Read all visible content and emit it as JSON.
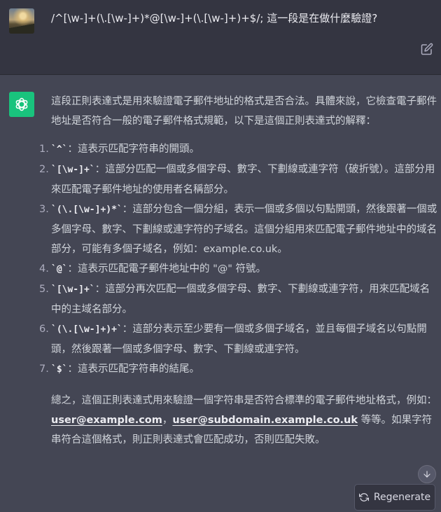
{
  "user_message": {
    "text": "/^[\\w-]+(\\.[\\w-]+)*@[\\w-]+(\\.[\\w-]+)+$/; 這一段是在做什麼驗證?"
  },
  "assistant_message": {
    "intro": "這段正則表達式是用來驗證電子郵件地址的格式是否合法。具體來說，它檢查電子郵件地址是否符合一般的電子郵件格式規範，以下是這個正則表達式的解釋：",
    "items": [
      {
        "num": "1.",
        "code": "`^`",
        "text": "：這表示匹配字符串的開頭。"
      },
      {
        "num": "2.",
        "code": "`[\\w-]+`",
        "text": "：這部分匹配一個或多個字母、數字、下劃線或連字符（破折號）。這部分用來匹配電子郵件地址的使用者名稱部分。"
      },
      {
        "num": "3.",
        "code": "`(\\.[\\w-]+)*`",
        "text": "：這部分包含一個分組，表示一個或多個以句點開頭，然後跟著一個或多個字母、數字、下劃線或連字符的子域名。這個分組用來匹配電子郵件地址中的域名部分，可能有多個子域名，例如：example.co.uk。"
      },
      {
        "num": "4.",
        "code": "`@`",
        "text": "：這表示匹配電子郵件地址中的 \"@\" 符號。"
      },
      {
        "num": "5.",
        "code": "`[\\w-]+`",
        "text": "：這部分再次匹配一個或多個字母、數字、下劃線或連字符，用來匹配域名中的主域名部分。"
      },
      {
        "num": "6.",
        "code": "`(\\.[\\w-]+)+`",
        "text": "：這部分表示至少要有一個或多個子域名，並且每個子域名以句點開頭，然後跟著一個或多個字母、數字、下劃線或連字符。"
      },
      {
        "num": "7.",
        "code": "`$`",
        "text": "：這表示匹配字符串的結尾。"
      }
    ],
    "summary_before": "總之，這個正則表達式用來驗證一個字符串是否符合標準的電子郵件地址格式，例如：",
    "example1": "user@example.com",
    "separator": "，",
    "example2": "user@subdomain.example.co.uk",
    "summary_after": " 等等。如果字符串符合這個格式，則正則表達式會匹配成功，否則匹配失敗。"
  },
  "controls": {
    "regenerate_label": "Regenerate",
    "icons": [
      "edit-icon",
      "openai-logo-icon",
      "arrow-down-icon",
      "refresh-icon"
    ]
  },
  "colors": {
    "user_bg": "#343541",
    "assistant_bg": "#444654",
    "brand_green": "#19c37d"
  }
}
